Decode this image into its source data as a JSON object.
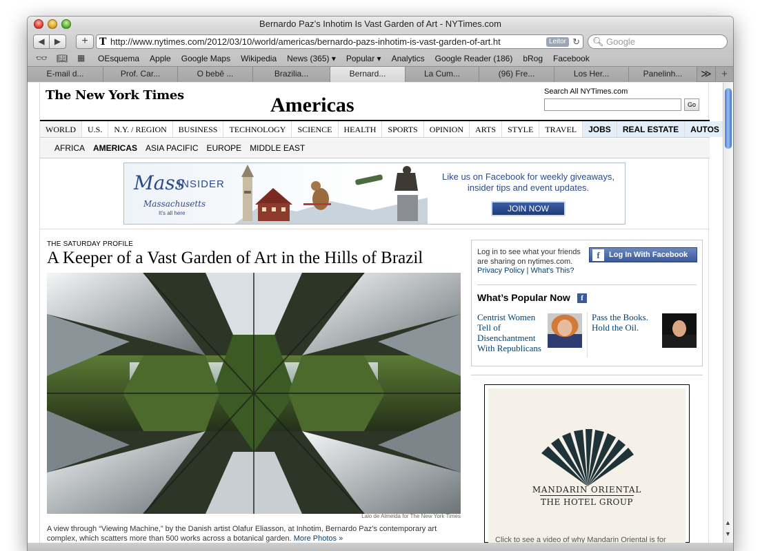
{
  "window": {
    "title": "Bernardo Paz’s Inhotim Is Vast Garden of Art - NYTimes.com"
  },
  "toolbar": {
    "back_icon": "◀",
    "forward_icon": "▶",
    "new_tab_icon": "+",
    "url": "http://www.nytimes.com/2012/03/10/world/americas/bernardo-pazs-inhotim-is-vast-garden-of-art.ht",
    "url_favicon": "T",
    "reader_label": "Leitor",
    "search_placeholder": "Google"
  },
  "bookmarks": {
    "items": [
      "OEsquema",
      "Apple",
      "Google Maps",
      "Wikipedia",
      "News (365) ▾",
      "Popular ▾",
      "Analytics",
      "Google Reader (186)",
      "bRog",
      "Facebook"
    ]
  },
  "tabs": {
    "items": [
      "E-mail d...",
      "Prof. Car...",
      "O bebê ...",
      "Brazilia...",
      "Bernard...",
      "La Cum...",
      "(96) Fre...",
      "Los Her...",
      "Panelinh..."
    ],
    "active_index": 4
  },
  "nyt": {
    "logo": "The New York Times",
    "section": "Americas",
    "search_label": "Search All NYTimes.com",
    "go_label": "Go",
    "nav": [
      "WORLD",
      "U.S.",
      "N.Y. / REGION",
      "BUSINESS",
      "TECHNOLOGY",
      "SCIENCE",
      "HEALTH",
      "SPORTS",
      "OPINION",
      "ARTS",
      "STYLE",
      "TRAVEL",
      "JOBS",
      "REAL ESTATE",
      "AUTOS"
    ],
    "subnav": [
      "AFRICA",
      "AMERICAS",
      "ASIA PACIFIC",
      "EUROPE",
      "MIDDLE EAST"
    ],
    "subnav_active": "AMERICAS"
  },
  "banner": {
    "brand": "Mass",
    "brand_suffix": "INSIDER",
    "state": "Massachusetts",
    "tagline": "It's all here",
    "promo": "Like us on Facebook for weekly giveaways, insider tips and event updates.",
    "cta": "JOIN NOW"
  },
  "article": {
    "kicker": "THE SATURDAY PROFILE",
    "headline": "A Keeper of a Vast Garden of Art in the Hills of Brazil",
    "photo_credit": "Lalo de Almeida for The New York Times",
    "caption": "A view through “Viewing Machine,” by the Danish artist Olafur Eliasson, at Inhotim, Bernardo Paz’s contemporary art complex, which scatters more than 500 works across a botanical garden.",
    "more_photos": "More Photos »"
  },
  "sidebar": {
    "login_text": "Log in to see what your friends are sharing on nytimes.com.",
    "privacy_link": "Privacy Policy",
    "whats_this_link": "What's This?",
    "fb_button": "Log In With Facebook",
    "popular_title": "What’s Popular Now",
    "popular": [
      {
        "title": "Centrist Women Tell of Disenchantment With Republicans"
      },
      {
        "title": "Pass the Books. Hold the Oil."
      }
    ]
  },
  "ad": {
    "name": "MANDARIN ORIENTAL",
    "group": "THE HOTEL GROUP",
    "cut_text": "Click to see a video of why Mandarin Oriental is for"
  },
  "colors": {
    "link": "#004276",
    "facebook": "#3b5998",
    "nav_ad_bg": "#e4eef8"
  }
}
